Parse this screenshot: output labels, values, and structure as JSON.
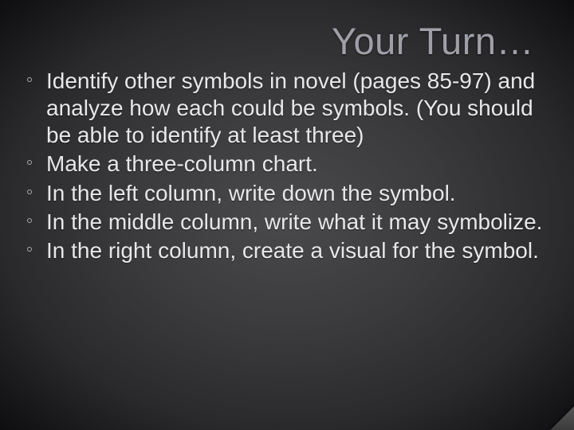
{
  "slide": {
    "title": "Your Turn…",
    "bullets": [
      "Identify other symbols in novel (pages 85-97) and analyze how each could be symbols. (You should be able to identify at least three)",
      "Make a three-column chart.",
      "In the left column, write down the symbol.",
      "In the middle column, write what it may symbolize.",
      "In the right column, create a visual for the symbol."
    ]
  }
}
